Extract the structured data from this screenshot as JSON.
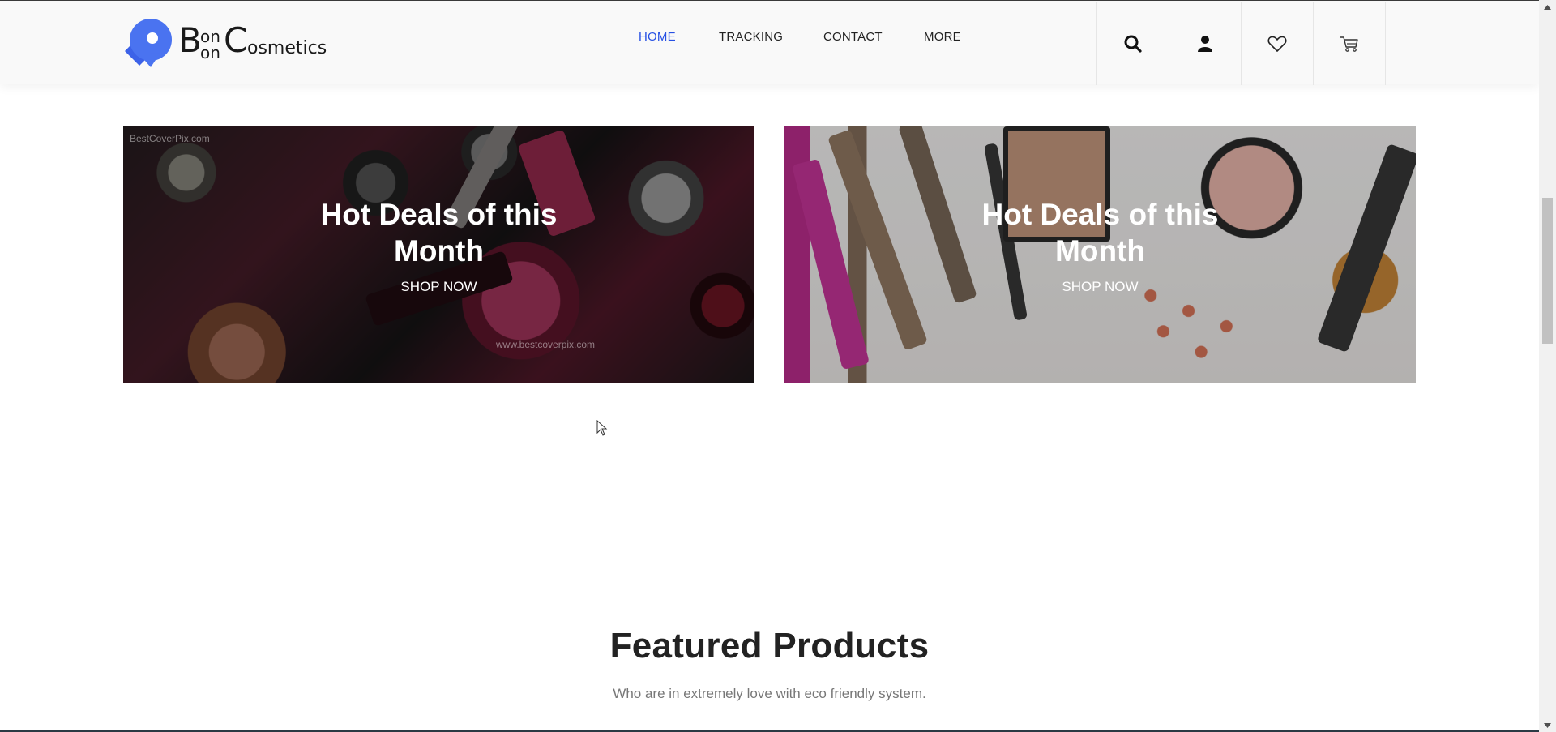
{
  "brand": {
    "logo_b1": "B",
    "logo_on1": "on",
    "logo_on2": "on",
    "logo_c": "C",
    "logo_rest": "osmetics",
    "accent_color": "#2650e4"
  },
  "nav": {
    "items": [
      {
        "label": "HOME",
        "active": true
      },
      {
        "label": "TRACKING",
        "active": false
      },
      {
        "label": "CONTACT",
        "active": false
      },
      {
        "label": "MORE",
        "active": false
      }
    ]
  },
  "header_icons": [
    "search-icon",
    "user-icon",
    "heart-icon",
    "cart-icon"
  ],
  "banners": [
    {
      "title_line1": "Hot Deals of this",
      "title_line2": "Month",
      "cta": "SHOP NOW",
      "watermark_top": "BestCoverPix.com",
      "watermark_bottom": "www.bestcoverpix.com"
    },
    {
      "title_line1": "Hot Deals of this",
      "title_line2": "Month",
      "cta": "SHOP NOW"
    }
  ],
  "featured": {
    "title": "Featured Products",
    "subtitle": "Who are in extremely love with eco friendly system."
  }
}
